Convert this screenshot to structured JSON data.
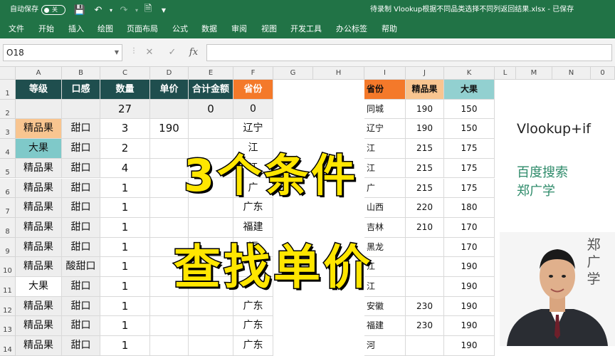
{
  "titlebar": {
    "autosave_label": "自动保存",
    "autosave_state": "关",
    "title": "待录制 Vlookup根据不同品类选择不同列返回结果.xlsx  -  已保存",
    "icons": [
      "save-icon",
      "undo-icon",
      "redo-icon",
      "file-check-icon",
      "more-icon"
    ]
  },
  "menu": [
    "文件",
    "开始",
    "插入",
    "绘图",
    "页面布局",
    "公式",
    "数据",
    "审阅",
    "视图",
    "开发工具",
    "办公标签",
    "帮助"
  ],
  "formula_bar": {
    "name_box": "O18",
    "fx_label": "fx",
    "formula": ""
  },
  "columns": [
    "A",
    "B",
    "C",
    "D",
    "E",
    "F",
    "G",
    "H",
    "I",
    "J",
    "K",
    "L",
    "M",
    "N",
    "0"
  ],
  "rows": [
    "1",
    "2",
    "3",
    "4",
    "5",
    "6",
    "7",
    "8",
    "9",
    "10",
    "11",
    "12",
    "13",
    "14"
  ],
  "left_table": {
    "headers": [
      "等级",
      "口感",
      "数量",
      "单价",
      "合计金额",
      "省份"
    ],
    "header_colors": [
      "#1f4e4e",
      "#1f4e4e",
      "#1f4e4e",
      "#1f4e4e",
      "#1f4e4e",
      "#f4792a"
    ],
    "rows": [
      [
        "",
        "",
        "27",
        "",
        "0",
        "0"
      ],
      [
        "精品果",
        "甜口",
        "3",
        "190",
        "",
        "辽宁"
      ],
      [
        "大果",
        "甜口",
        "2",
        "",
        "",
        "江"
      ],
      [
        "精品果",
        "甜口",
        "4",
        "",
        "",
        "江"
      ],
      [
        "精品果",
        "甜口",
        "1",
        "",
        "",
        "广"
      ],
      [
        "精品果",
        "甜口",
        "1",
        "",
        "",
        "广东"
      ],
      [
        "精品果",
        "甜口",
        "1",
        "",
        "",
        "福建"
      ],
      [
        "精品果",
        "甜口",
        "1",
        "",
        "",
        "福"
      ],
      [
        "精品果",
        "酸甜口",
        "1",
        "",
        "",
        ""
      ],
      [
        "大果",
        "甜口",
        "1",
        "",
        "",
        ""
      ],
      [
        "精品果",
        "甜口",
        "1",
        "",
        "",
        "广东"
      ],
      [
        "精品果",
        "甜口",
        "1",
        "",
        "",
        "广东"
      ],
      [
        "精品果",
        "甜口",
        "1",
        "",
        "",
        "广东"
      ]
    ]
  },
  "right_table": {
    "headers": [
      "省份",
      "精品果",
      "大果"
    ],
    "header_colors": [
      "#f4792a",
      "#f8c590",
      "#92d0d0"
    ],
    "rows": [
      [
        "同城",
        "190",
        "150"
      ],
      [
        "辽宁",
        "190",
        "150"
      ],
      [
        "江",
        "215",
        "175"
      ],
      [
        "江",
        "215",
        "175"
      ],
      [
        "广",
        "215",
        "175"
      ],
      [
        "山西",
        "220",
        "180"
      ],
      [
        "吉林",
        "210",
        "170"
      ],
      [
        "黑龙",
        "",
        "170"
      ],
      [
        "江",
        "",
        "190"
      ],
      [
        "江",
        "",
        "190"
      ],
      [
        "安徽",
        "230",
        "190"
      ],
      [
        "福建",
        "230",
        "190"
      ],
      [
        "河",
        "",
        "190"
      ]
    ]
  },
  "side_panel": {
    "title": "Vlookup+if",
    "line1": "百度搜索",
    "line2": "郑广学",
    "vertical_name": "郑广学"
  },
  "overlay": {
    "line1": "3个条件",
    "line2": "查找单价"
  }
}
